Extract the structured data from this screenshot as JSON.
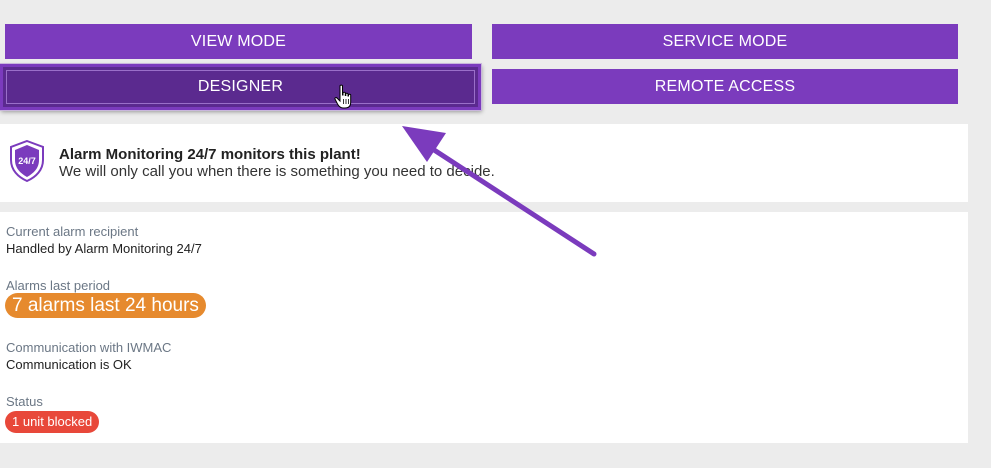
{
  "buttons": {
    "view_mode": "VIEW MODE",
    "service_mode": "SERVICE MODE",
    "designer": "DESIGNER",
    "remote_access": "REMOTE ACCESS"
  },
  "banner": {
    "badge_text": "24/7",
    "title": "Alarm Monitoring 24/7 monitors this plant!",
    "subtitle": "We will only call you when there is something you need to decide."
  },
  "details": {
    "recipient_label": "Current alarm recipient",
    "recipient_value": "Handled by Alarm Monitoring 24/7",
    "alarms_label": "Alarms last period",
    "alarms_value": "7 alarms last 24 hours",
    "comm_label": "Communication with IWMAC",
    "comm_value": "Communication is OK",
    "status_label": "Status",
    "status_value": "1 unit blocked"
  },
  "colors": {
    "button": "#7b3bbd",
    "button_active": "#5b2a8f",
    "alarm_pill": "#e68a2e",
    "status_pill": "#e8483a",
    "arrow": "#7b3bbd"
  }
}
